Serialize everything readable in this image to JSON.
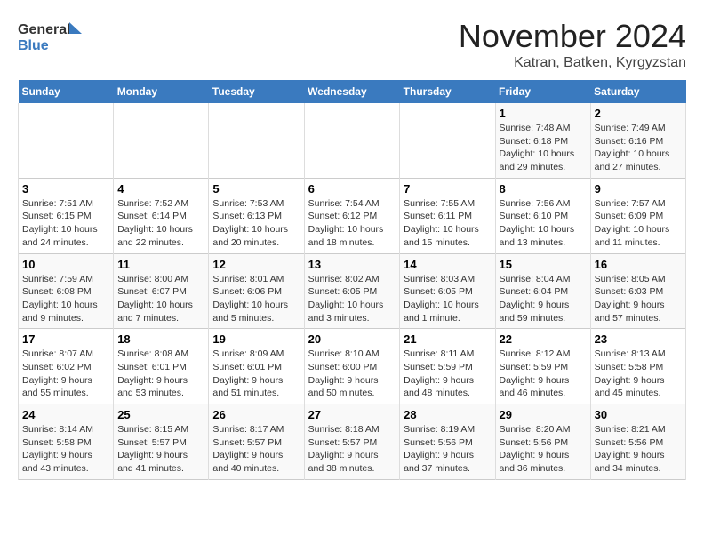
{
  "header": {
    "logo_line1": "General",
    "logo_line2": "Blue",
    "month": "November 2024",
    "location": "Katran, Batken, Kyrgyzstan"
  },
  "weekdays": [
    "Sunday",
    "Monday",
    "Tuesday",
    "Wednesday",
    "Thursday",
    "Friday",
    "Saturday"
  ],
  "weeks": [
    [
      {
        "day": "",
        "info": ""
      },
      {
        "day": "",
        "info": ""
      },
      {
        "day": "",
        "info": ""
      },
      {
        "day": "",
        "info": ""
      },
      {
        "day": "",
        "info": ""
      },
      {
        "day": "1",
        "info": "Sunrise: 7:48 AM\nSunset: 6:18 PM\nDaylight: 10 hours and 29 minutes."
      },
      {
        "day": "2",
        "info": "Sunrise: 7:49 AM\nSunset: 6:16 PM\nDaylight: 10 hours and 27 minutes."
      }
    ],
    [
      {
        "day": "3",
        "info": "Sunrise: 7:51 AM\nSunset: 6:15 PM\nDaylight: 10 hours and 24 minutes."
      },
      {
        "day": "4",
        "info": "Sunrise: 7:52 AM\nSunset: 6:14 PM\nDaylight: 10 hours and 22 minutes."
      },
      {
        "day": "5",
        "info": "Sunrise: 7:53 AM\nSunset: 6:13 PM\nDaylight: 10 hours and 20 minutes."
      },
      {
        "day": "6",
        "info": "Sunrise: 7:54 AM\nSunset: 6:12 PM\nDaylight: 10 hours and 18 minutes."
      },
      {
        "day": "7",
        "info": "Sunrise: 7:55 AM\nSunset: 6:11 PM\nDaylight: 10 hours and 15 minutes."
      },
      {
        "day": "8",
        "info": "Sunrise: 7:56 AM\nSunset: 6:10 PM\nDaylight: 10 hours and 13 minutes."
      },
      {
        "day": "9",
        "info": "Sunrise: 7:57 AM\nSunset: 6:09 PM\nDaylight: 10 hours and 11 minutes."
      }
    ],
    [
      {
        "day": "10",
        "info": "Sunrise: 7:59 AM\nSunset: 6:08 PM\nDaylight: 10 hours and 9 minutes."
      },
      {
        "day": "11",
        "info": "Sunrise: 8:00 AM\nSunset: 6:07 PM\nDaylight: 10 hours and 7 minutes."
      },
      {
        "day": "12",
        "info": "Sunrise: 8:01 AM\nSunset: 6:06 PM\nDaylight: 10 hours and 5 minutes."
      },
      {
        "day": "13",
        "info": "Sunrise: 8:02 AM\nSunset: 6:05 PM\nDaylight: 10 hours and 3 minutes."
      },
      {
        "day": "14",
        "info": "Sunrise: 8:03 AM\nSunset: 6:05 PM\nDaylight: 10 hours and 1 minute."
      },
      {
        "day": "15",
        "info": "Sunrise: 8:04 AM\nSunset: 6:04 PM\nDaylight: 9 hours and 59 minutes."
      },
      {
        "day": "16",
        "info": "Sunrise: 8:05 AM\nSunset: 6:03 PM\nDaylight: 9 hours and 57 minutes."
      }
    ],
    [
      {
        "day": "17",
        "info": "Sunrise: 8:07 AM\nSunset: 6:02 PM\nDaylight: 9 hours and 55 minutes."
      },
      {
        "day": "18",
        "info": "Sunrise: 8:08 AM\nSunset: 6:01 PM\nDaylight: 9 hours and 53 minutes."
      },
      {
        "day": "19",
        "info": "Sunrise: 8:09 AM\nSunset: 6:01 PM\nDaylight: 9 hours and 51 minutes."
      },
      {
        "day": "20",
        "info": "Sunrise: 8:10 AM\nSunset: 6:00 PM\nDaylight: 9 hours and 50 minutes."
      },
      {
        "day": "21",
        "info": "Sunrise: 8:11 AM\nSunset: 5:59 PM\nDaylight: 9 hours and 48 minutes."
      },
      {
        "day": "22",
        "info": "Sunrise: 8:12 AM\nSunset: 5:59 PM\nDaylight: 9 hours and 46 minutes."
      },
      {
        "day": "23",
        "info": "Sunrise: 8:13 AM\nSunset: 5:58 PM\nDaylight: 9 hours and 45 minutes."
      }
    ],
    [
      {
        "day": "24",
        "info": "Sunrise: 8:14 AM\nSunset: 5:58 PM\nDaylight: 9 hours and 43 minutes."
      },
      {
        "day": "25",
        "info": "Sunrise: 8:15 AM\nSunset: 5:57 PM\nDaylight: 9 hours and 41 minutes."
      },
      {
        "day": "26",
        "info": "Sunrise: 8:17 AM\nSunset: 5:57 PM\nDaylight: 9 hours and 40 minutes."
      },
      {
        "day": "27",
        "info": "Sunrise: 8:18 AM\nSunset: 5:57 PM\nDaylight: 9 hours and 38 minutes."
      },
      {
        "day": "28",
        "info": "Sunrise: 8:19 AM\nSunset: 5:56 PM\nDaylight: 9 hours and 37 minutes."
      },
      {
        "day": "29",
        "info": "Sunrise: 8:20 AM\nSunset: 5:56 PM\nDaylight: 9 hours and 36 minutes."
      },
      {
        "day": "30",
        "info": "Sunrise: 8:21 AM\nSunset: 5:56 PM\nDaylight: 9 hours and 34 minutes."
      }
    ]
  ]
}
